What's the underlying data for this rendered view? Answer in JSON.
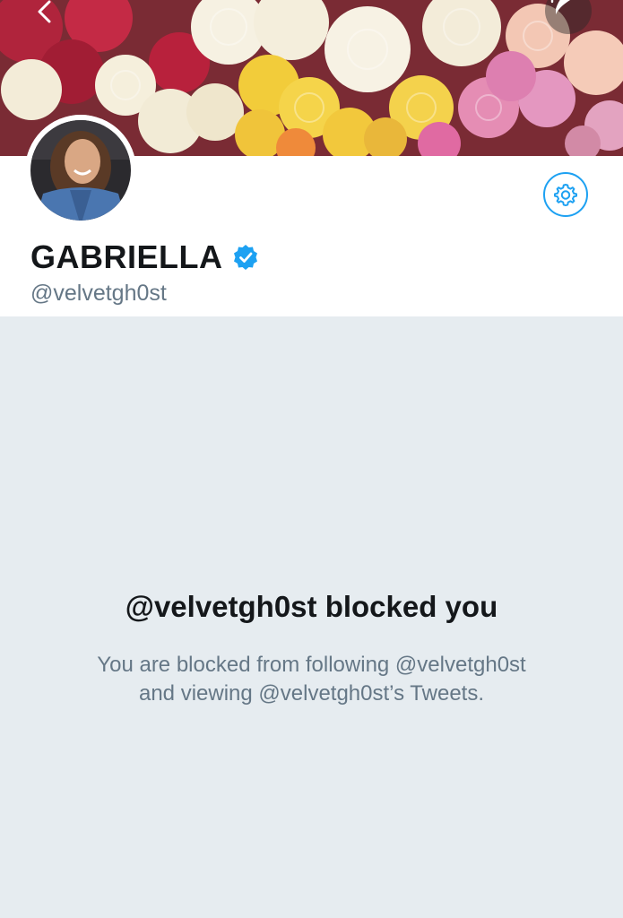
{
  "header": {
    "back_icon": "chevron-left-icon",
    "compose_icon": "compose-tweet-icon"
  },
  "profile": {
    "display_name": "GABRIELLA",
    "handle": "@velvetgh0st",
    "verified_icon": "verified-badge-icon",
    "settings_icon": "gear-icon"
  },
  "blocked": {
    "title": "@velvetgh0st blocked you",
    "line1": "You are blocked from following @velvetgh0st",
    "line2": "and viewing @velvetgh0st’s Tweets."
  },
  "colors": {
    "accent": "#1da1f2",
    "background": "#e6ecf0",
    "text_primary": "#14171a",
    "text_secondary": "#657786"
  }
}
